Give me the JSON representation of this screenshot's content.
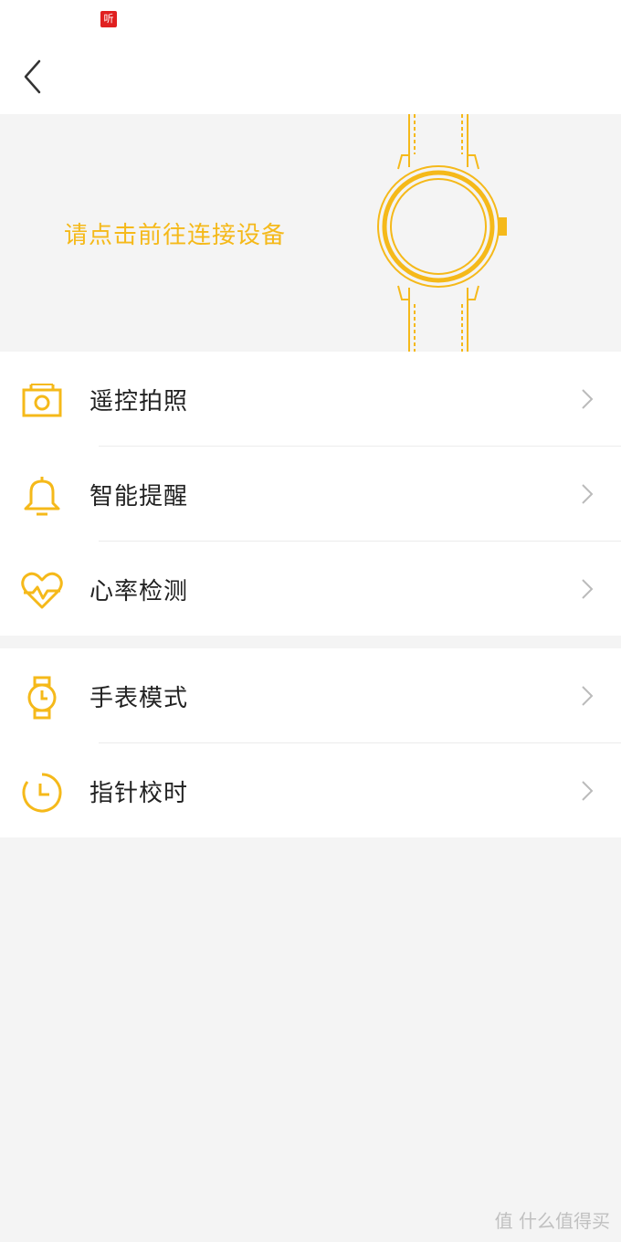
{
  "status_bar": {
    "badge": "听"
  },
  "banner": {
    "connect_prompt": "请点击前往连接设备"
  },
  "groups": [
    {
      "items": [
        {
          "label": "遥控拍照",
          "icon": "camera-icon"
        },
        {
          "label": "智能提醒",
          "icon": "bell-icon"
        },
        {
          "label": "心率检测",
          "icon": "heart-rate-icon"
        }
      ]
    },
    {
      "items": [
        {
          "label": "手表模式",
          "icon": "watch-icon"
        },
        {
          "label": "指针校时",
          "icon": "clock-icon"
        }
      ]
    }
  ],
  "watermark": {
    "text": "值 什么值得买"
  },
  "colors": {
    "accent": "#f5b91a",
    "background": "#f4f4f4"
  }
}
